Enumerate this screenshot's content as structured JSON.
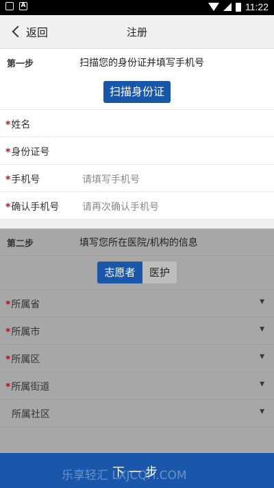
{
  "status_bar": {
    "time": "11:22"
  },
  "header": {
    "back_label": "返回",
    "title": "注册"
  },
  "step1": {
    "label": "第一步",
    "text": "扫描您的身份证并填写手机号",
    "scan_button": "扫描身份证",
    "fields": [
      {
        "label": "姓名",
        "value": ""
      },
      {
        "label": "身份证号",
        "value": ""
      },
      {
        "label": "手机号",
        "value": "请填写手机号"
      },
      {
        "label": "确认手机号",
        "value": "请再次确认手机号"
      }
    ]
  },
  "step2": {
    "label": "第二步",
    "text": "填写您所在医院/机构的信息",
    "toggle": {
      "active": "志愿者",
      "inactive": "医护"
    },
    "fields": [
      {
        "label": "所属省"
      },
      {
        "label": "所属市"
      },
      {
        "label": "所属区"
      },
      {
        "label": "所属街道"
      },
      {
        "label": "所属社区"
      }
    ]
  },
  "footer": {
    "next_label": "下一步",
    "watermark": "乐享轻汇 LXJCQH.COM"
  },
  "colors": {
    "accent": "#1a56a9",
    "required": "#d0021b"
  }
}
